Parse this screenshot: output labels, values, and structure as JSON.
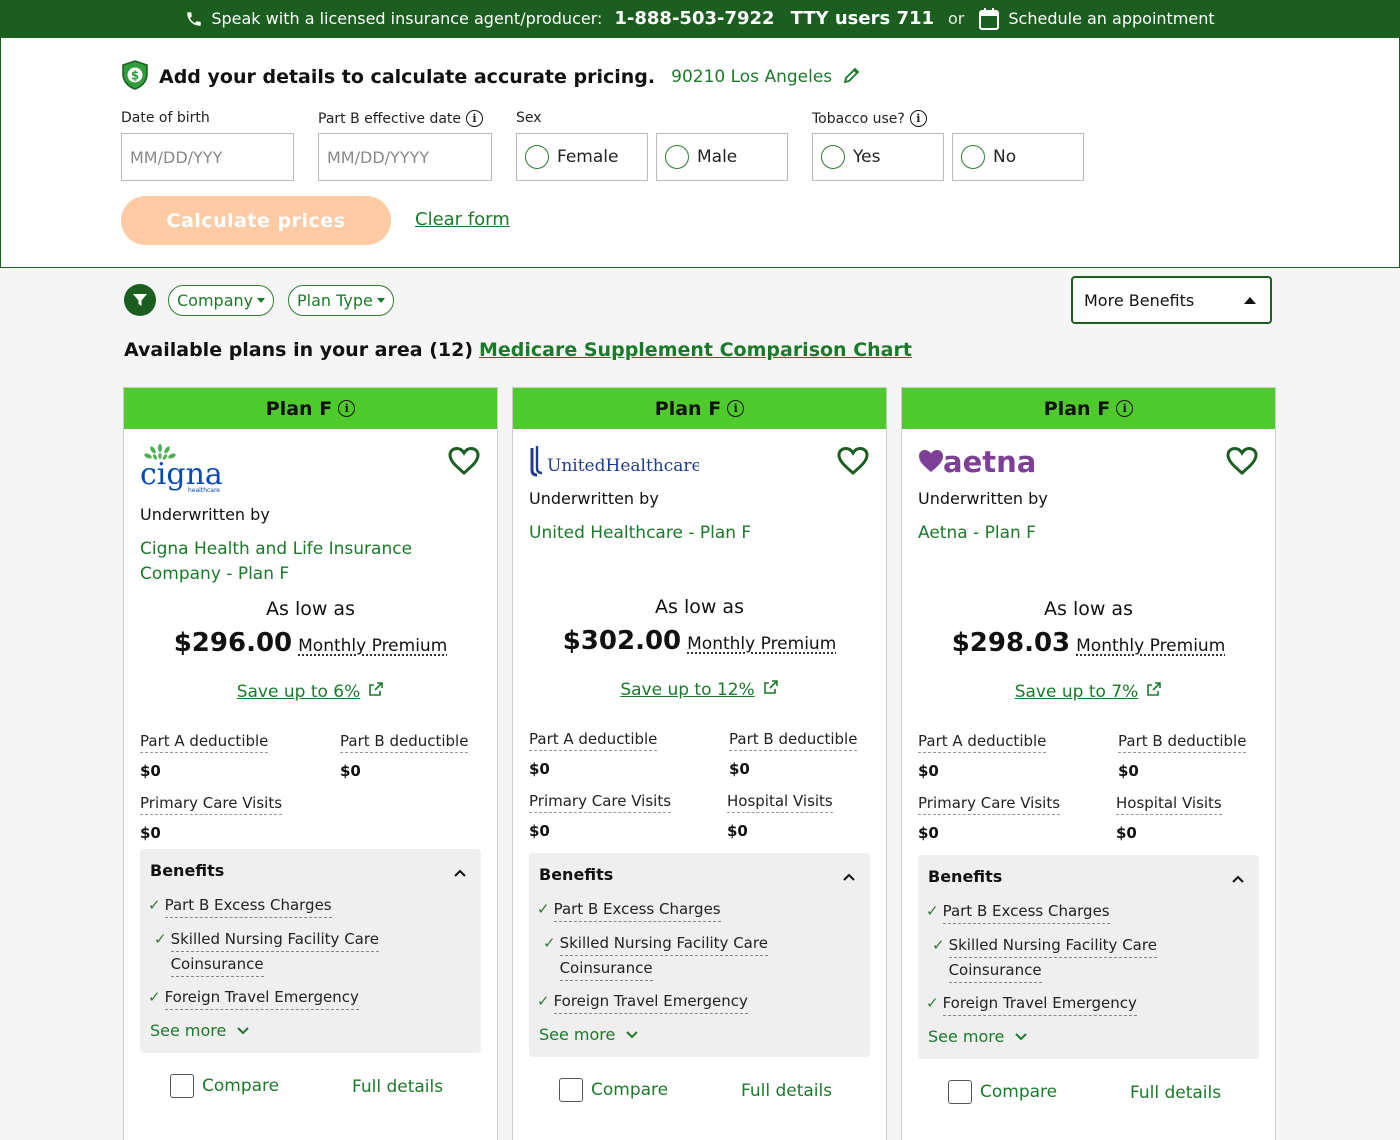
{
  "topbar": {
    "speak_text": "Speak with a licensed insurance agent/producer:",
    "phone": "1-888-503-7922",
    "tty": "TTY users 711",
    "or": "or",
    "schedule": "Schedule an appointment",
    "bg_color": "#1b5e20"
  },
  "details": {
    "title": "Add your details to calculate accurate pricing.",
    "location": "90210 Los Angeles",
    "dob_label": "Date of birth",
    "dob_placeholder": "MM/DD/YYY",
    "partb_label": "Part B effective date",
    "partb_placeholder": "MM/DD/YYYY",
    "sex_label": "Sex",
    "sex_options": [
      "Female",
      "Male"
    ],
    "tobacco_label": "Tobacco use?",
    "tobacco_options": [
      "Yes",
      "No"
    ],
    "calculate_label": "Calculate prices",
    "clear_label": "Clear form"
  },
  "filters": {
    "company": "Company",
    "plan_type": "Plan Type",
    "more_benefits": "More Benefits"
  },
  "available": {
    "text": "Available plans in your area (12)",
    "chart_link": "Medicare Supplement Comparison Chart"
  },
  "cards": [
    {
      "plan": "Plan F",
      "brand": "cigna",
      "brand_sub": "healthcare",
      "underwritten_label": "Underwritten by",
      "company": "Cigna Health and Life Insurance Company - Plan F",
      "as_low_as": "As low as",
      "price": "$296.00",
      "monthly": "Monthly Premium",
      "save": "Save up to 6%",
      "part_a_label": "Part A deductible",
      "part_a_value": "$0",
      "part_b_label": "Part B deductible",
      "part_b_value": "$0",
      "primary_label": "Primary Care Visits",
      "primary_value": "$0",
      "hospital_label": "",
      "hospital_value": "",
      "benefits_title": "Benefits",
      "benefits": [
        "Part B Excess Charges",
        "Skilled Nursing Facility Care",
        "Coinsurance",
        "Foreign Travel Emergency"
      ],
      "see_more": "See more",
      "compare": "Compare",
      "full_details": "Full details"
    },
    {
      "plan": "Plan F",
      "brand": "UnitedHealthcare",
      "underwritten_label": "Underwritten by",
      "company": "United Healthcare - Plan F",
      "as_low_as": "As low as",
      "price": "$302.00",
      "monthly": "Monthly Premium",
      "save": "Save up to 12%",
      "part_a_label": "Part A deductible",
      "part_a_value": "$0",
      "part_b_label": "Part B deductible",
      "part_b_value": "$0",
      "primary_label": "Primary Care Visits",
      "primary_value": "$0",
      "hospital_label": "Hospital Visits",
      "hospital_value": "$0",
      "benefits_title": "Benefits",
      "benefits": [
        "Part B Excess Charges",
        "Skilled Nursing Facility Care",
        "Coinsurance",
        "Foreign Travel Emergency"
      ],
      "see_more": "See more",
      "compare": "Compare",
      "full_details": "Full details"
    },
    {
      "plan": "Plan F",
      "brand": "aetna",
      "underwritten_label": "Underwritten by",
      "company": "Aetna - Plan F",
      "as_low_as": "As low as",
      "price": "$298.03",
      "monthly": "Monthly Premium",
      "save": "Save up to 7%",
      "part_a_label": "Part A deductible",
      "part_a_value": "$0",
      "part_b_label": "Part B deductible",
      "part_b_value": "$0",
      "primary_label": "Primary Care Visits",
      "primary_value": "$0",
      "hospital_label": "Hospital Visits",
      "hospital_value": "$0",
      "benefits_title": "Benefits",
      "benefits": [
        "Part B Excess Charges",
        "Skilled Nursing Facility Care",
        "Coinsurance",
        "Foreign Travel Emergency"
      ],
      "see_more": "See more",
      "compare": "Compare",
      "full_details": "Full details"
    }
  ]
}
